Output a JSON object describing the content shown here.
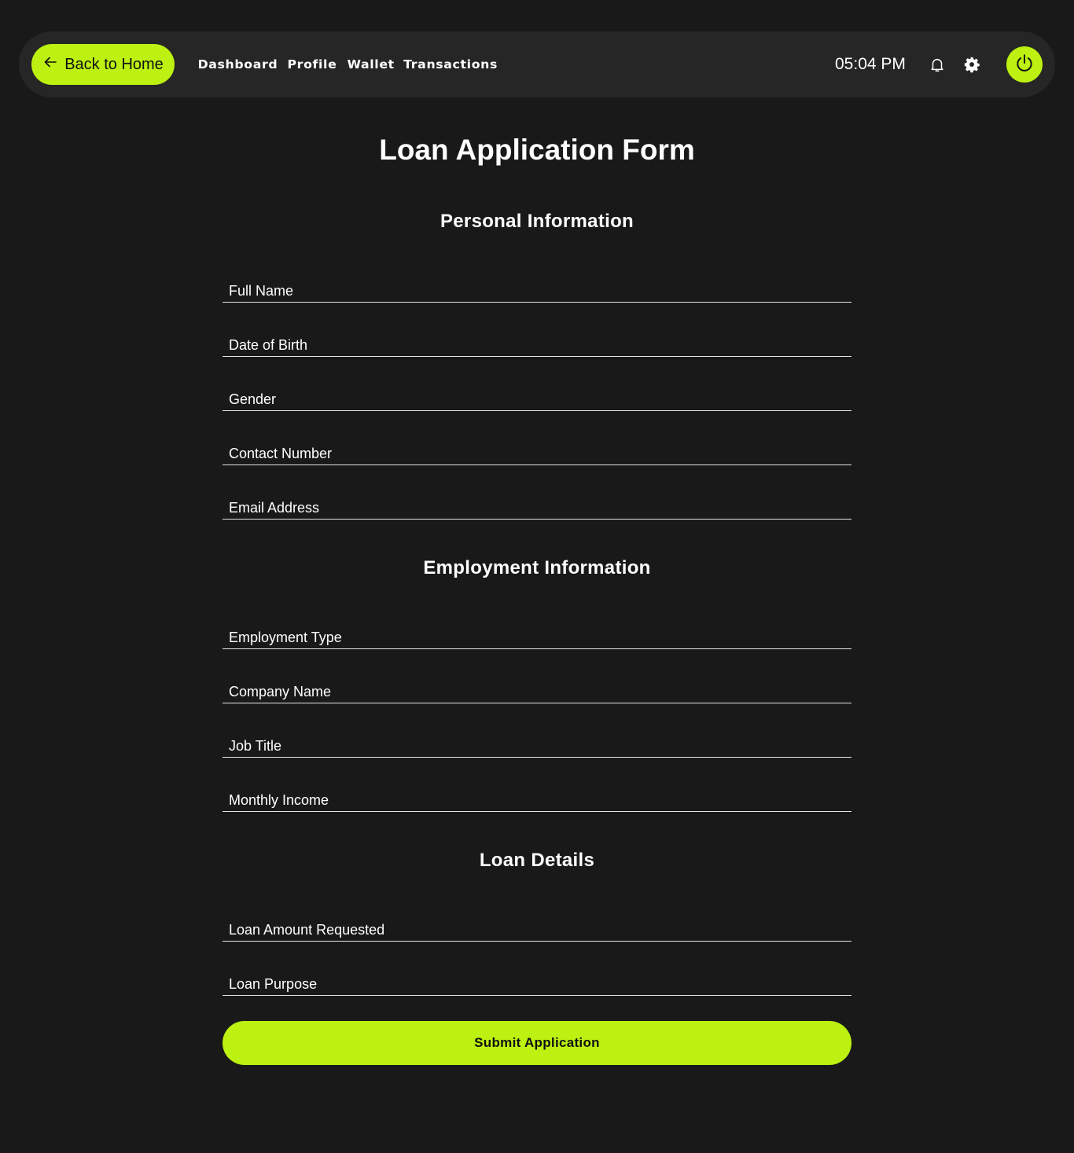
{
  "nav": {
    "back_label": "Back to Home",
    "links": [
      "Dashboard",
      "Profile",
      "Wallet",
      "Transactions"
    ],
    "time": "05:04 PM",
    "accent_color": "#bcf111",
    "icons": [
      "arrow-left-icon",
      "bell-icon",
      "gear-icon",
      "power-icon"
    ]
  },
  "form": {
    "title": "Loan Application Form",
    "sections": [
      {
        "title": "Personal Information",
        "fields": [
          "Full Name",
          "Date of Birth",
          "Gender",
          "Contact Number",
          "Email Address"
        ]
      },
      {
        "title": "Employment Information",
        "fields": [
          "Employment Type",
          "Company Name",
          "Job Title",
          "Monthly Income"
        ]
      },
      {
        "title": "Loan Details",
        "fields": [
          "Loan Amount Requested",
          "Loan Purpose"
        ]
      }
    ],
    "submit_label": "Submit Application"
  }
}
